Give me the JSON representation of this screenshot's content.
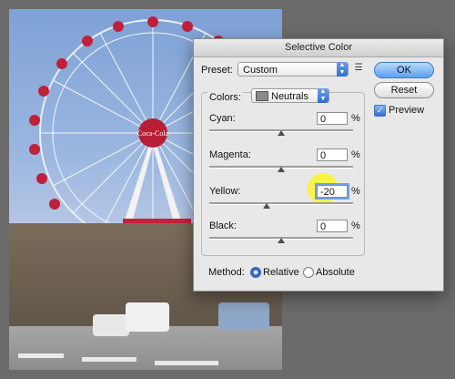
{
  "dialog": {
    "title": "Selective Color",
    "preset_label": "Preset:",
    "preset_value": "Custom",
    "colors_label": "Colors:",
    "colors_value": "Neutrals",
    "sliders": [
      {
        "label": "Cyan:",
        "value": "0",
        "unit": "%"
      },
      {
        "label": "Magenta:",
        "value": "0",
        "unit": "%"
      },
      {
        "label": "Yellow:",
        "value": "-20",
        "unit": "%"
      },
      {
        "label": "Black:",
        "value": "0",
        "unit": "%"
      }
    ],
    "buttons": {
      "ok": "OK",
      "cancel": "Reset"
    },
    "preview_label": "Preview",
    "preview_checked": true,
    "method_label": "Method:",
    "method_options": [
      "Relative",
      "Absolute"
    ],
    "method_selected": "Relative"
  },
  "photo": {
    "logo_text": "Coca-Cola"
  },
  "colors": {
    "accent": "#2f6ed1",
    "highlight": "#fff528"
  }
}
